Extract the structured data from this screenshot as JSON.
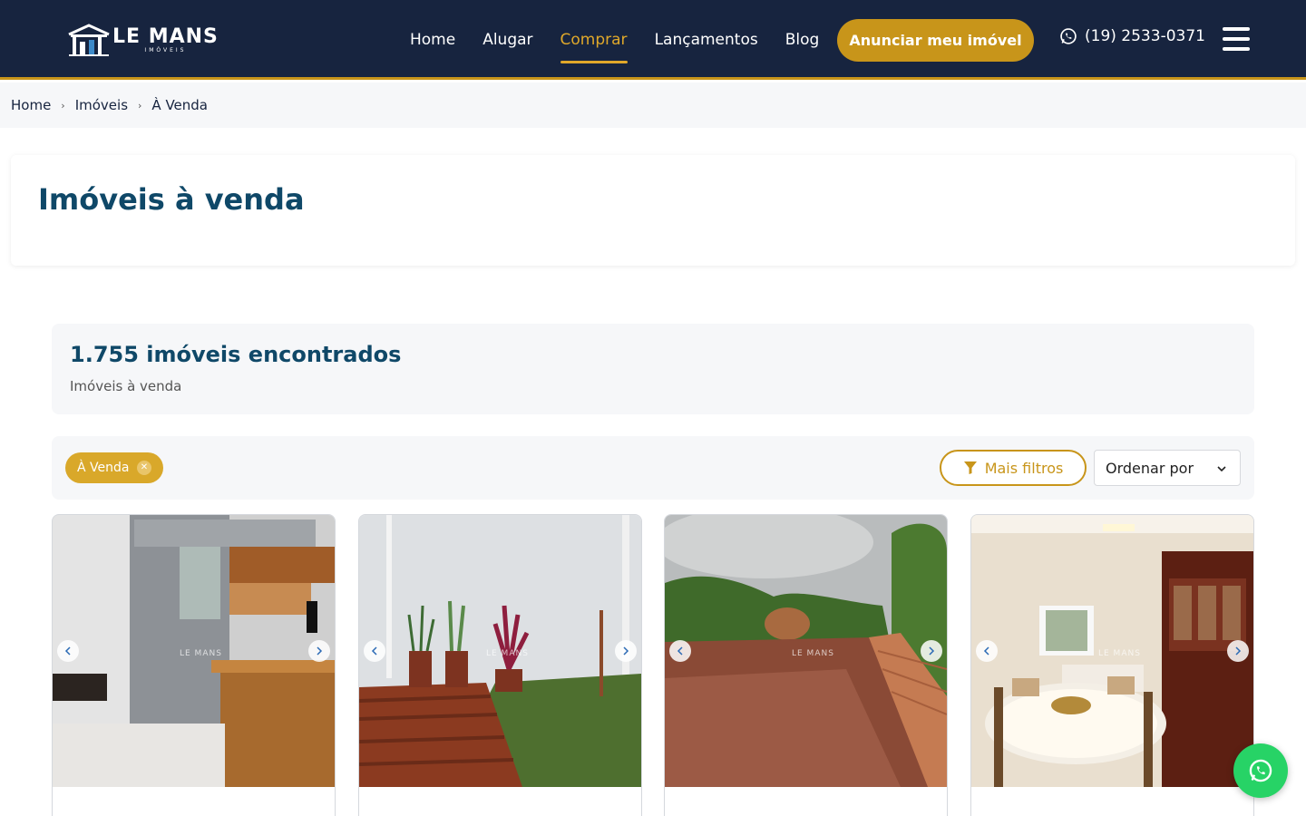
{
  "header": {
    "logo_main": "LE MANS",
    "logo_sub": "IMÓVEIS",
    "nav": [
      "Home",
      "Alugar",
      "Comprar",
      "Lançamentos",
      "Blog"
    ],
    "active_nav": "Comprar",
    "cta_label": "Anunciar meu imóvel",
    "phone": "(19) 2533-0371"
  },
  "breadcrumb": [
    "Home",
    "Imóveis",
    "À Venda"
  ],
  "page_title": "Imóveis à venda",
  "results": {
    "count": "1.755",
    "count_suffix": " imóveis encontrados",
    "subtitle": "Imóveis à venda"
  },
  "filters": {
    "active_chip": "À Venda",
    "more_filters_label": "Mais filtros",
    "sort_label": "Ordenar por"
  },
  "listings": [
    {
      "photo": "kitchen-cabinets"
    },
    {
      "photo": "garden-deck"
    },
    {
      "photo": "dirt-lot"
    },
    {
      "photo": "dining-living-room"
    }
  ],
  "colors": {
    "header_bg": "#17243f",
    "accent": "#c8951a",
    "title": "#0f4868",
    "whatsapp": "#27d366"
  }
}
